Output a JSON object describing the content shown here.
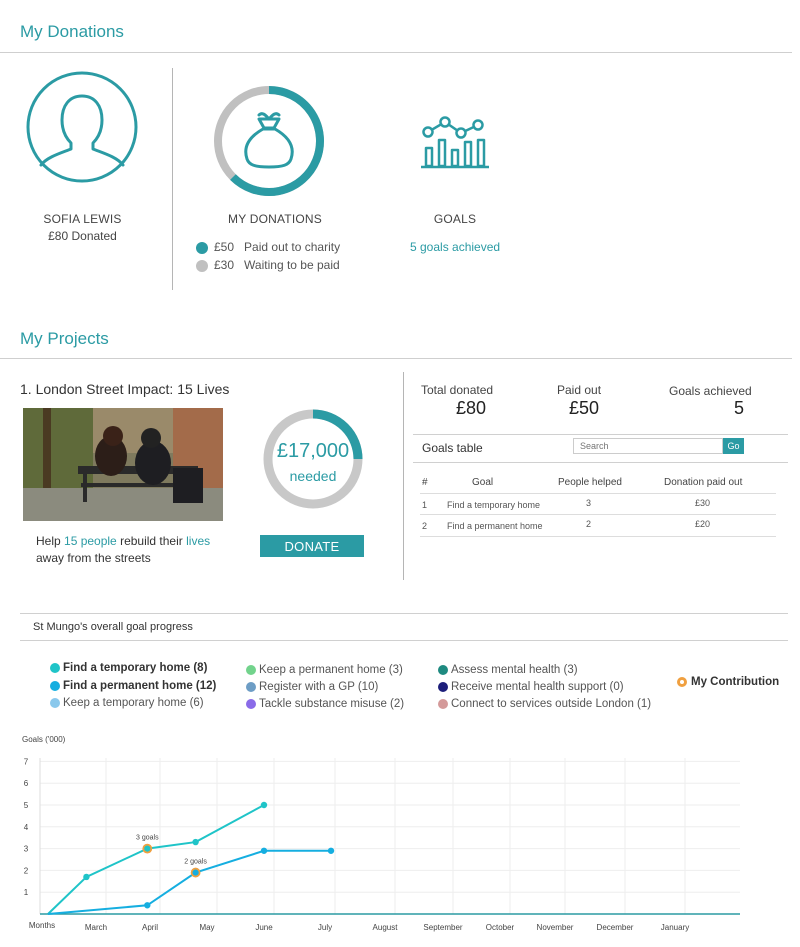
{
  "donations_section": {
    "title": "My Donations",
    "user": {
      "name": "SOFIA LEWIS",
      "donated": "£80 Donated"
    },
    "my_donations": {
      "heading": "MY DONATIONS",
      "paid_fraction": 0.625,
      "paid_color": "#2b9ba4",
      "waiting_color": "#c0c0c0",
      "items": [
        {
          "amount": "£50",
          "label": "Paid out to charity"
        },
        {
          "amount": "£30",
          "label": "Waiting to be paid"
        }
      ],
      "icon": "money-bag-icon"
    },
    "goals": {
      "heading": "GOALS",
      "achieved": "5 goals achieved",
      "icon": "chart-growth-icon"
    }
  },
  "projects_section": {
    "title": "My Projects",
    "project": {
      "title": "1. London Street Impact: 15 Lives",
      "needed_amount": "£17,000",
      "needed_label": "needed",
      "progress_fraction": 0.25,
      "desc_before": "Help ",
      "desc_people": "15 people",
      "desc_middle": " rebuild their ",
      "desc_lives": "lives",
      "desc_after": " away from the streets",
      "donate_label": "DONATE"
    },
    "stats": [
      {
        "label": "Total donated",
        "value": "£80"
      },
      {
        "label": "Paid out",
        "value": "£50"
      },
      {
        "label": "Goals achieved",
        "value": "5"
      }
    ],
    "goals_table": {
      "title": "Goals table",
      "search_placeholder": "Search",
      "go_label": "Go",
      "columns": [
        "#",
        "Goal",
        "People helped",
        "Donation paid out"
      ],
      "rows": [
        [
          "1",
          "Find a temporary home",
          "3",
          "£30"
        ],
        [
          "2",
          "Find a permanent home",
          "2",
          "£20"
        ]
      ]
    }
  },
  "progress_section": {
    "title": "St Mungo's overall goal progress",
    "legend": [
      {
        "label": "Find a temporary home (8)",
        "color": "#1fc4c8",
        "bold": true
      },
      {
        "label": "Find a permanent home (12)",
        "color": "#15aee0",
        "bold": true
      },
      {
        "label": "Keep a temporary home (6)",
        "color": "#8ac8ec",
        "bold": false
      },
      {
        "label": "Keep a permanent home (3)",
        "color": "#72d38c",
        "bold": false
      },
      {
        "label": "Register with a GP (10)",
        "color": "#6d9dc5",
        "bold": false
      },
      {
        "label": "Tackle substance misuse (2)",
        "color": "#8a6be8",
        "bold": false
      },
      {
        "label": "Assess mental health (3)",
        "color": "#1e8a80",
        "bold": false
      },
      {
        "label": "Receive mental health support (0)",
        "color": "#1c1e7a",
        "bold": false
      },
      {
        "label": "Connect to services outside London (1)",
        "color": "#d49a9a",
        "bold": false
      }
    ],
    "my_contribution": {
      "label": "My Contribution",
      "color": "#f0a040"
    }
  },
  "chart_data": {
    "type": "line",
    "ylabel": "Goals ('000)",
    "xlabel": "Months",
    "ylim": [
      0,
      7
    ],
    "yticks": [
      1,
      2,
      3,
      4,
      5,
      6,
      7
    ],
    "categories": [
      "March",
      "April",
      "May",
      "June",
      "July",
      "August",
      "September",
      "October",
      "November",
      "December",
      "January"
    ],
    "grid": true,
    "series": [
      {
        "name": "Find a temporary home (8)",
        "color": "#1fc4c8",
        "points": [
          [
            0,
            0
          ],
          [
            0.8,
            1.7
          ],
          [
            1.95,
            3.0
          ],
          [
            2.8,
            3.3
          ],
          [
            4.0,
            5.0
          ]
        ]
      },
      {
        "name": "Find a permanent home (12)",
        "color": "#15aee0",
        "points": [
          [
            0,
            0
          ],
          [
            1.95,
            0.4
          ],
          [
            2.8,
            1.9
          ],
          [
            4.0,
            2.9
          ],
          [
            5.1,
            2.9
          ]
        ]
      }
    ],
    "contributions": [
      {
        "series": 0,
        "point": 2,
        "label": "3 goals"
      },
      {
        "series": 1,
        "point": 2,
        "label": "2 goals"
      }
    ]
  }
}
